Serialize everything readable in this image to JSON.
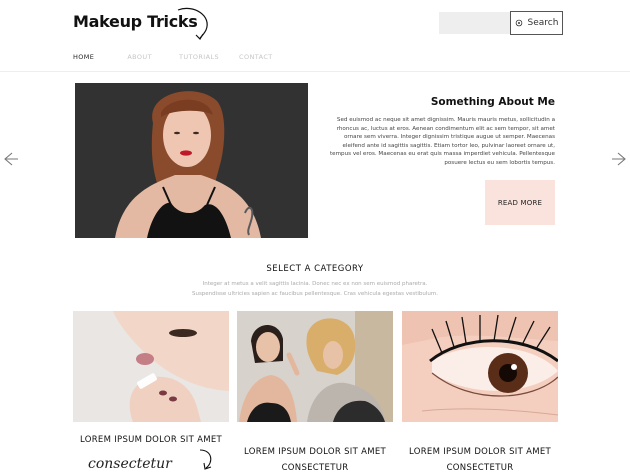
{
  "header": {
    "logo": "Makeup Tricks",
    "search_placeholder": "",
    "search_button": "Search"
  },
  "nav": {
    "items": [
      {
        "label": "HOME",
        "active": true
      },
      {
        "label": "ABOUT",
        "active": false
      },
      {
        "label": "TUTORIALS",
        "active": false
      },
      {
        "label": "CONTACT",
        "active": false
      }
    ]
  },
  "hero": {
    "title": "Something About Me",
    "text": "Sed euismod ac neque sit amet dignissim. Mauris mauris metus, sollicitudin a rhoncus ac, luctus at eros. Aenean condimentum elit ac sem tempor, sit amet ornare sem viverra. Integer dignissim tristique augue ut semper. Maecenas eleifend ante id sagittis sagittis. Etiam tortor leo, pulvinar laoreet ornare ut, tempus vel eros. Maecenas eu erat quis massa imperdiet vehicula. Pellentesque posuere lectus eu sem lobortis tempus.",
    "button": "READ MORE"
  },
  "category": {
    "title": "SELECT A CATEGORY",
    "subtitle_1": "Integer at metus a velit sagittis lacinia. Donec nec ex non sem euismod pharetra.",
    "subtitle_2": "Suspendisse ultricies sapien ac faucibus pellentesque. Cras vehicula egestas vestibulum."
  },
  "cards": [
    {
      "title": "LOREM IPSUM DOLOR SIT AMET",
      "subtitle": "consectetur"
    },
    {
      "title": "LOREM IPSUM DOLOR SIT AMET",
      "subtitle": "CONSECTETUR"
    },
    {
      "title": "LOREM IPSUM DOLOR SIT AMET",
      "subtitle": "CONSECTETUR"
    }
  ],
  "icons": {
    "search": "search-icon",
    "prev": "arrow-left-icon",
    "next": "arrow-right-icon"
  },
  "colors": {
    "accent": "#fbe3dd",
    "nav_inactive": "#c6c6c6",
    "search_bg": "#eeeeee"
  }
}
